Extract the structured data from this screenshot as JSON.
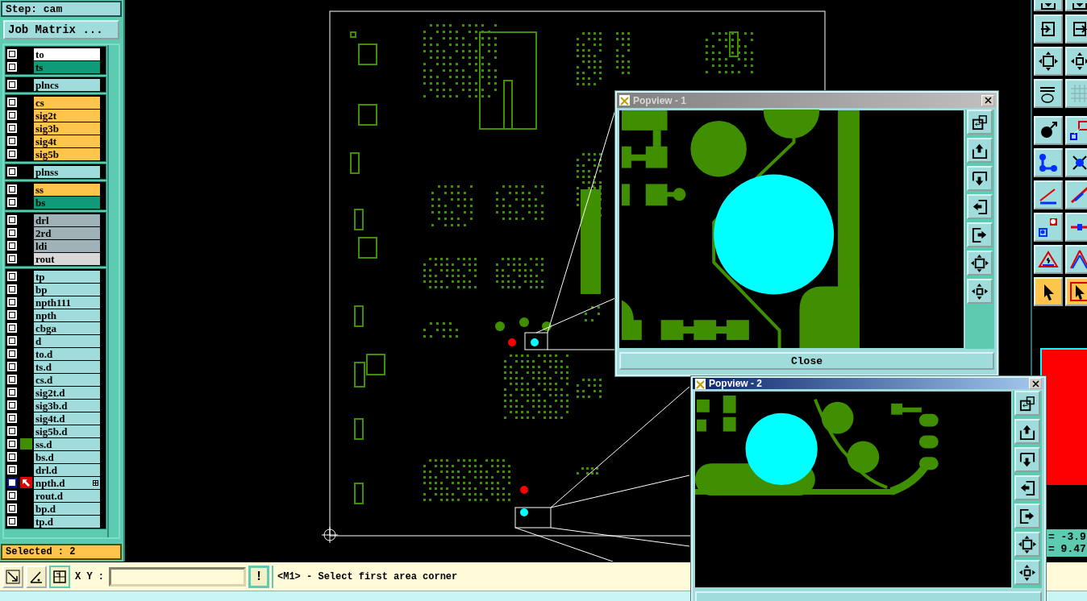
{
  "step_label": "Step: cam",
  "job_matrix_button": "Job Matrix ...",
  "layer_groups": [
    [
      {
        "name": "to",
        "color": "#ffffff",
        "checked": false,
        "displayed": false,
        "work": false
      },
      {
        "name": "ts",
        "color": "#0f9a78",
        "checked": false,
        "displayed": false,
        "work": false
      }
    ],
    [
      {
        "name": "plncs",
        "color": "#a0dcdc",
        "checked": false,
        "displayed": false,
        "work": false
      }
    ],
    [
      {
        "name": "cs",
        "color": "#ffc44c",
        "checked": false,
        "displayed": false,
        "work": false
      },
      {
        "name": "sig2t",
        "color": "#ffc44c",
        "checked": false,
        "displayed": false,
        "work": false
      },
      {
        "name": "sig3b",
        "color": "#ffc44c",
        "checked": false,
        "displayed": false,
        "work": false
      },
      {
        "name": "sig4t",
        "color": "#ffc44c",
        "checked": false,
        "displayed": false,
        "work": false
      },
      {
        "name": "sig5b",
        "color": "#ffc44c",
        "checked": false,
        "displayed": false,
        "work": false
      }
    ],
    [
      {
        "name": "plnss",
        "color": "#a0dcdc",
        "checked": false,
        "displayed": false,
        "work": false
      }
    ],
    [
      {
        "name": "ss",
        "color": "#ffc44c",
        "checked": false,
        "displayed": false,
        "work": false
      },
      {
        "name": "bs",
        "color": "#0f9a78",
        "checked": false,
        "displayed": false,
        "work": false
      }
    ],
    [
      {
        "name": "drl",
        "color": "#9fb2b8",
        "checked": false,
        "displayed": false,
        "work": false
      },
      {
        "name": "2rd",
        "color": "#9fb2b8",
        "checked": false,
        "displayed": false,
        "work": false
      },
      {
        "name": "ldi",
        "color": "#9fb2b8",
        "checked": false,
        "displayed": false,
        "work": false
      },
      {
        "name": "rout",
        "color": "#d8d8d8",
        "checked": false,
        "displayed": false,
        "work": false
      }
    ],
    [
      {
        "name": "tp",
        "color": "#a0dcdc",
        "checked": false,
        "displayed": false,
        "work": false
      },
      {
        "name": "bp",
        "color": "#a0dcdc",
        "checked": false,
        "displayed": false,
        "work": false
      },
      {
        "name": "npth111",
        "color": "#a0dcdc",
        "checked": false,
        "displayed": false,
        "work": false
      },
      {
        "name": "npth",
        "color": "#a0dcdc",
        "checked": false,
        "displayed": false,
        "work": false
      },
      {
        "name": "cbga",
        "color": "#a0dcdc",
        "checked": false,
        "displayed": false,
        "work": false
      },
      {
        "name": "d",
        "color": "#a0dcdc",
        "checked": false,
        "displayed": false,
        "work": false
      },
      {
        "name": "to.d",
        "color": "#a0dcdc",
        "checked": false,
        "displayed": false,
        "work": false
      },
      {
        "name": "ts.d",
        "color": "#a0dcdc",
        "checked": false,
        "displayed": false,
        "work": false
      },
      {
        "name": "cs.d",
        "color": "#a0dcdc",
        "checked": false,
        "displayed": false,
        "work": false
      },
      {
        "name": "sig2t.d",
        "color": "#a0dcdc",
        "checked": false,
        "displayed": false,
        "work": false
      },
      {
        "name": "sig3b.d",
        "color": "#a0dcdc",
        "checked": false,
        "displayed": false,
        "work": false
      },
      {
        "name": "sig4t.d",
        "color": "#a0dcdc",
        "checked": false,
        "displayed": false,
        "work": false
      },
      {
        "name": "sig5b.d",
        "color": "#a0dcdc",
        "checked": false,
        "displayed": false,
        "work": false
      },
      {
        "name": "ss.d",
        "color": "#a0dcdc",
        "checked": false,
        "displayed": true,
        "work": false
      },
      {
        "name": "bs.d",
        "color": "#a0dcdc",
        "checked": false,
        "displayed": false,
        "work": false
      },
      {
        "name": "drl.d",
        "color": "#a0dcdc",
        "checked": false,
        "displayed": false,
        "work": false
      },
      {
        "name": "npth.d",
        "color": "#a0dcdc",
        "checked": false,
        "displayed": false,
        "work": true
      },
      {
        "name": "rout.d",
        "color": "#a0dcdc",
        "checked": false,
        "displayed": false,
        "work": false
      },
      {
        "name": "bp.d",
        "color": "#a0dcdc",
        "checked": false,
        "displayed": false,
        "work": false
      },
      {
        "name": "tp.d",
        "color": "#a0dcdc",
        "checked": false,
        "displayed": false,
        "work": false
      }
    ]
  ],
  "selected_count": "Selected : 2",
  "right_toolbar": [
    {
      "selected": false
    },
    {
      "selected": false
    },
    {
      "selected": false
    },
    {
      "selected": false
    },
    {
      "selected": false
    },
    {
      "selected": false
    },
    {
      "selected": false
    },
    {
      "selected": false
    },
    {
      "selected": false
    },
    {
      "selected": false
    },
    {
      "selected": false
    },
    {
      "selected": false
    },
    {
      "selected": false
    },
    {
      "selected": false
    },
    {
      "selected": false
    },
    {
      "selected": false
    },
    {
      "selected": false
    },
    {
      "selected": false
    },
    {
      "selected": true
    },
    {
      "selected": true
    }
  ],
  "coordinates": [
    "= -3.9",
    "= 9.47"
  ],
  "bottom_bar": {
    "xy_label": "X Y :",
    "help_button": "!",
    "prompt": "<M1> - Select first area corner"
  },
  "popviews": [
    {
      "title": "Popview - 1",
      "active": false,
      "close_button": "Close"
    },
    {
      "title": "Popview - 2",
      "active": true
    }
  ]
}
